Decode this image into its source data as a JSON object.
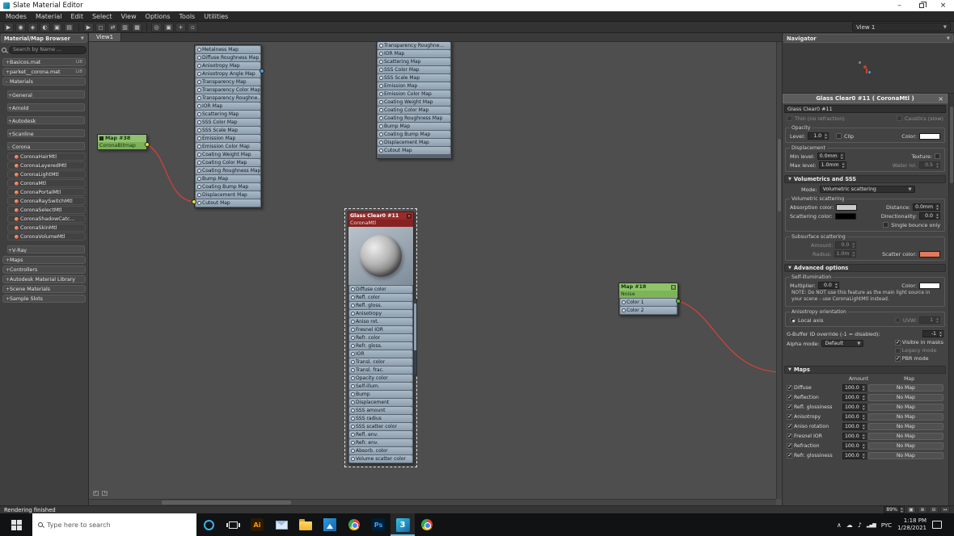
{
  "window": {
    "title": "Slate Material Editor"
  },
  "menu": {
    "items": [
      "Modes",
      "Material",
      "Edit",
      "Select",
      "View",
      "Options",
      "Tools",
      "Utilities"
    ]
  },
  "toolbar": {
    "view_selector": "View 1",
    "groupA": [
      {
        "name": "select-tool-icon",
        "glyph": "▶"
      },
      {
        "name": "pick-material-icon",
        "glyph": "◉"
      },
      {
        "name": "assign-material-icon",
        "glyph": "◈"
      },
      {
        "name": "show-shaded-material-icon",
        "glyph": "◐"
      },
      {
        "name": "show-end-result-icon",
        "glyph": "▣"
      },
      {
        "name": "layout-all-icon",
        "glyph": "▤"
      }
    ],
    "groupB": [
      {
        "name": "select-node-icon",
        "glyph": "▶"
      },
      {
        "name": "select-region-icon",
        "glyph": "◻"
      },
      {
        "name": "move-children-icon",
        "glyph": "⇄"
      },
      {
        "name": "hide-unused-nodeslots-icon",
        "glyph": "▥"
      },
      {
        "name": "show-grid-icon",
        "glyph": "▦"
      }
    ],
    "groupC": [
      {
        "name": "zoom-tool-icon",
        "glyph": "◎"
      },
      {
        "name": "zoom-region-icon",
        "glyph": "▣"
      },
      {
        "name": "pan-tool-icon",
        "glyph": "+"
      },
      {
        "name": "zoom-extents-icon",
        "glyph": "▫"
      }
    ]
  },
  "view_tab": "View1",
  "browser": {
    "title": "Material/Map Browser",
    "search_placeholder": "Search by Name ...",
    "items": [
      {
        "label": "Basicos.mat",
        "kind": "lib",
        "prefix": "+",
        "badge": "LIB"
      },
      {
        "label": "parket__corona.mat",
        "kind": "lib",
        "prefix": "+",
        "badge": "LIB"
      },
      {
        "label": "Materials",
        "kind": "root",
        "prefix": "-",
        "badge": ""
      },
      {
        "label": "General",
        "kind": "group",
        "prefix": "+",
        "badge": ""
      },
      {
        "label": "Arnold",
        "kind": "group",
        "prefix": "+",
        "badge": ""
      },
      {
        "label": "Autodesk",
        "kind": "group",
        "prefix": "+",
        "badge": ""
      },
      {
        "label": "Scanline",
        "kind": "group",
        "prefix": "+",
        "badge": ""
      },
      {
        "label": "Corona",
        "kind": "group",
        "prefix": "-",
        "badge": ""
      },
      {
        "label": "CoronaHairMtl",
        "kind": "mtl",
        "prefix": "",
        "badge": ""
      },
      {
        "label": "CoronaLayeredMtl",
        "kind": "mtl",
        "prefix": "",
        "badge": ""
      },
      {
        "label": "CoronaLightMtl",
        "kind": "mtl",
        "prefix": "",
        "badge": ""
      },
      {
        "label": "CoronaMtl",
        "kind": "mtl",
        "prefix": "",
        "badge": ""
      },
      {
        "label": "CoronaPortalMtl",
        "kind": "mtl",
        "prefix": "",
        "badge": ""
      },
      {
        "label": "CoronaRaySwitchMtl",
        "kind": "mtl",
        "prefix": "",
        "badge": ""
      },
      {
        "label": "CoronaSelectMtl",
        "kind": "mtl",
        "prefix": "",
        "badge": ""
      },
      {
        "label": "CoronaShadowCatc...",
        "kind": "mtl",
        "prefix": "",
        "badge": ""
      },
      {
        "label": "CoronaSkinMtl",
        "kind": "mtl",
        "prefix": "",
        "badge": ""
      },
      {
        "label": "CoronaVolumeMtl",
        "kind": "mtl",
        "prefix": "",
        "badge": ""
      },
      {
        "label": "V-Ray",
        "kind": "group",
        "prefix": "+",
        "badge": ""
      },
      {
        "label": "Maps",
        "kind": "root",
        "prefix": "+",
        "badge": ""
      },
      {
        "label": "Controllers",
        "kind": "root",
        "prefix": "+",
        "badge": ""
      },
      {
        "label": "Autodesk Material Library",
        "kind": "root",
        "prefix": "+",
        "badge": ""
      },
      {
        "label": "Scene Materials",
        "kind": "root",
        "prefix": "+",
        "badge": ""
      },
      {
        "label": "Sample Slots",
        "kind": "root",
        "prefix": "+",
        "badge": ""
      }
    ]
  },
  "nodes": {
    "stackA": {
      "slots": [
        "Metalness Map",
        "Diffuse Roughness Map",
        "Anisotropy Map",
        "Anisotropy Angle Map",
        "Transparency Map",
        "Transparency Color Map",
        "Transparency Roughne...",
        "IOR Map",
        "Scattering Map",
        "SSS Color Map",
        "SSS Scale Map",
        "Emission Map",
        "Emission Color Map",
        "Coating Weight Map",
        "Coating Color Map",
        "Coating Roughness Map",
        "Bump Map",
        "Coating Bump Map",
        "Displacement Map",
        "Cutout Map"
      ]
    },
    "stackB": {
      "slots": [
        "Transparency Roughne...",
        "IOR Map",
        "Scattering Map",
        "SSS Color Map",
        "SSS Scale Map",
        "Emission Map",
        "Emission Color Map",
        "Coating Weight Map",
        "Coating Color Map",
        "Coating Roughness Map",
        "Bump Map",
        "Coating Bump Map",
        "Displacement Map",
        "Cutout Map"
      ]
    },
    "bitmap": {
      "title": "Map #38",
      "subtitle": "CoronaBitmap"
    },
    "glass": {
      "title": "Glass Clear0 #11",
      "subtitle": "CoronaMtl",
      "slots": [
        "Diffuse color",
        "Refl. color",
        "Refl. gloss.",
        "Anisotropy",
        "Aniso rot.",
        "Fresnel IOR",
        "Refr. color",
        "Refr. gloss.",
        "IOR",
        "Transl. color",
        "Transl. frac.",
        "Opacity color",
        "Self-illum.",
        "Bump",
        "Displacement",
        "SSS amount",
        "SSS radius",
        "SSS scatter color",
        "Refl. env.",
        "Refr. env.",
        "Absorb. color",
        "Volume scatter color"
      ]
    },
    "noise": {
      "title": "Map #18",
      "subtitle": "Noise",
      "slots": [
        "Color 1",
        "Color 2"
      ]
    }
  },
  "nodeview_tools": [
    {
      "name": "pan-view-icon",
      "glyph": "◰"
    },
    {
      "name": "zoom-view-icon",
      "glyph": "◳"
    }
  ],
  "navigator": {
    "title": "Navigator"
  },
  "params": {
    "title": "Glass Clear0 #11  ( CoronaMtl )",
    "material_combo": "Glass Clear0 #11",
    "thin_label": "Thin (no refraction)",
    "caustics_label": "Caustics (slow)",
    "opacity": {
      "group": "Opacity",
      "level_label": "Level:",
      "level": "1.0",
      "clip_label": "Clip",
      "color_label": "Color:",
      "color": "#ffffff"
    },
    "displacement": {
      "group": "Displacement",
      "min_label": "Min level:",
      "min": "0.0mm",
      "texture_label": "Texture:",
      "max_label": "Max level:",
      "max": "1.0mm",
      "water_label": "Water lvl.",
      "water": "0.5"
    },
    "volumetrics": {
      "header": "Volumetrics and SSS",
      "mode_label": "Mode:",
      "mode": "Volumetric scattering",
      "vs_group": "Volumetric scattering",
      "absorption_label": "Absorption color:",
      "absorption_color": "#c8c8c8",
      "distance_label": "Distance:",
      "distance": "0.0mm",
      "scattering_label": "Scattering color:",
      "scattering_color": "#000000",
      "directionality_label": "Directionality:",
      "directionality": "0.0",
      "single_bounce_label": "Single bounce only",
      "sss_group": "Subsurface scattering",
      "amount_label": "Amount:",
      "amount": "0.0",
      "radius_label": "Radius:",
      "radius": "1.0m",
      "scatter_color_label": "Scatter color:",
      "scatter_color": "#e2795a"
    },
    "advanced": {
      "header": "Advanced options",
      "selfillum_group": "Self-illumination",
      "multiplier_label": "Multiplier:",
      "multiplier": "0.0",
      "color_label": "Color:",
      "selfillum_color": "#ffffff",
      "note": "NOTE: Do NOT use this feature as the main light source in your scene - use CoronaLightMtl instead.",
      "aniso_group": "Anisotropy orientation",
      "local_axis_label": "Local axis",
      "uvw_label": "UVW:",
      "uvw": "1",
      "gbuffer_label": "G-Buffer ID override (-1 = disabled):",
      "gbuffer": "-1",
      "alpha_label": "Alpha mode:",
      "alpha_mode": "Default",
      "visible_masks_label": "Visible in masks",
      "legacy_label": "Legacy mode",
      "pbr_label": "PBR mode"
    },
    "maps": {
      "header": "Maps",
      "amount_col": "Amount",
      "map_col": "Map",
      "rows": [
        {
          "name": "Diffuse",
          "amount": "100.0",
          "map": "No Map"
        },
        {
          "name": "Reflection",
          "amount": "100.0",
          "map": "No Map"
        },
        {
          "name": "Refl. glossiness",
          "amount": "100.0",
          "map": "No Map"
        },
        {
          "name": "Anisotropy",
          "amount": "100.0",
          "map": "No Map"
        },
        {
          "name": "Aniso rotation",
          "amount": "100.0",
          "map": "No Map"
        },
        {
          "name": "Fresnel IOR",
          "amount": "100.0",
          "map": "No Map"
        },
        {
          "name": "Refraction",
          "amount": "100.0",
          "map": "No Map"
        },
        {
          "name": "Refr. glossiness",
          "amount": "100.0",
          "map": "No Map"
        }
      ]
    }
  },
  "status": {
    "message": "Rendering finished",
    "zoom": "89%",
    "icons": [
      {
        "name": "zoom-extents-status-icon",
        "glyph": "▣"
      },
      {
        "name": "zoom-in-status-icon",
        "glyph": "⊕"
      },
      {
        "name": "zoom-out-status-icon",
        "glyph": "⊖"
      },
      {
        "name": "pan-status-icon",
        "glyph": "↔"
      }
    ]
  },
  "taskbar": {
    "search_placeholder": "Type here to search",
    "apps": [
      {
        "name": "cortana-icon",
        "kind": "cortana",
        "text": "",
        "active": ""
      },
      {
        "name": "task-view-icon",
        "kind": "taskview",
        "text": "",
        "active": ""
      },
      {
        "name": "illustrator-icon",
        "kind": "ai",
        "text": "Ai",
        "active": ""
      },
      {
        "name": "mail-icon",
        "kind": "mail",
        "text": "",
        "active": ""
      },
      {
        "name": "file-explorer-icon",
        "kind": "folder",
        "text": "",
        "active": ""
      },
      {
        "name": "photos-icon",
        "kind": "photos",
        "text": "",
        "active": ""
      },
      {
        "name": "chrome-icon",
        "kind": "chrome",
        "text": "",
        "active": ""
      },
      {
        "name": "photoshop-icon",
        "kind": "ps",
        "text": "Ps",
        "active": ""
      },
      {
        "name": "3dsmax-icon",
        "kind": "max",
        "text": "3",
        "active": "active"
      },
      {
        "name": "browser-2-icon",
        "kind": "chrome",
        "text": "",
        "active": ""
      }
    ],
    "tray": {
      "icons": [
        {
          "name": "tray-expand-icon",
          "glyph": "∧",
          "kind": ""
        },
        {
          "name": "onedrive-icon",
          "glyph": "☁",
          "kind": ""
        },
        {
          "name": "volume-icon",
          "glyph": "♪",
          "kind": ""
        },
        {
          "name": "network-icon",
          "glyph": "▂▄▆",
          "kind": "bars"
        }
      ],
      "lang": "PYC",
      "time": "1:18 PM",
      "date": "1/28/2021"
    }
  },
  "colors": {
    "wire": "#cf4137",
    "map_node_green": "#8fc468",
    "material_node_red": "#9b2b2b",
    "slot_blue": "#9fb0c0",
    "taskbar_accent": "#6cb7e8"
  }
}
